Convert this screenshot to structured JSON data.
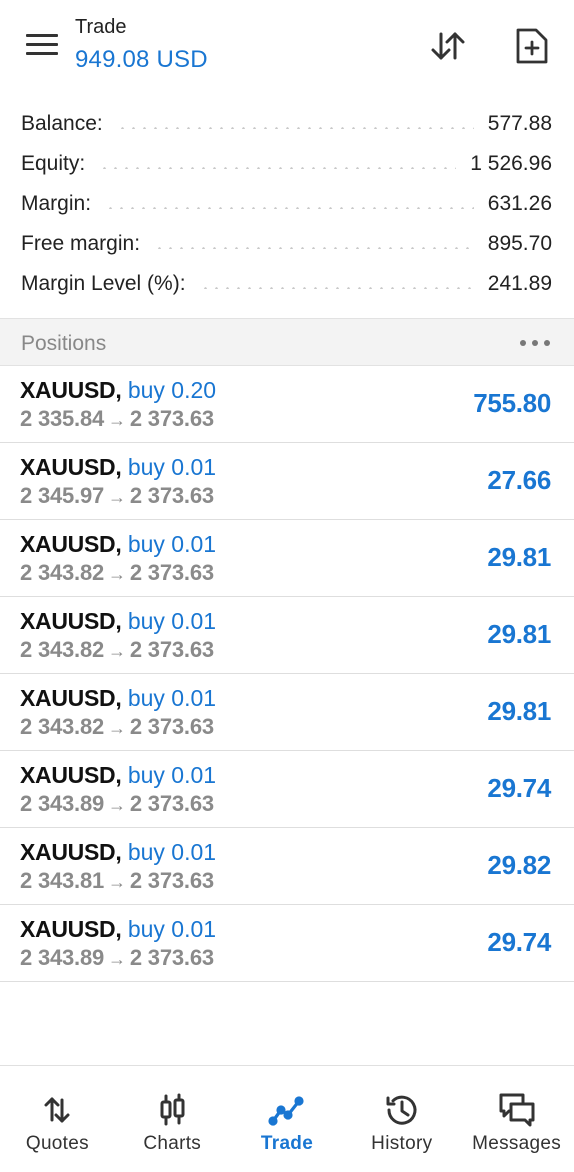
{
  "header": {
    "title": "Trade",
    "balance": "949.08 USD",
    "icons": [
      "menu-icon",
      "sort-icon",
      "new-order-icon"
    ]
  },
  "summary": [
    {
      "label": "Balance:",
      "value": "577.88"
    },
    {
      "label": "Equity:",
      "value": "1 526.96"
    },
    {
      "label": "Margin:",
      "value": "631.26"
    },
    {
      "label": "Free margin:",
      "value": "895.70"
    },
    {
      "label": "Margin Level (%):",
      "value": "241.89"
    }
  ],
  "positions_section": {
    "title": "Positions",
    "more_icon": "more-dots-icon"
  },
  "positions": [
    {
      "symbol": "XAUUSD,",
      "side": "buy 0.20",
      "open": "2 335.84",
      "arrow": "→",
      "current": "2 373.63",
      "profit": "755.80"
    },
    {
      "symbol": "XAUUSD,",
      "side": "buy 0.01",
      "open": "2 345.97",
      "arrow": "→",
      "current": "2 373.63",
      "profit": "27.66"
    },
    {
      "symbol": "XAUUSD,",
      "side": "buy 0.01",
      "open": "2 343.82",
      "arrow": "→",
      "current": "2 373.63",
      "profit": "29.81"
    },
    {
      "symbol": "XAUUSD,",
      "side": "buy 0.01",
      "open": "2 343.82",
      "arrow": "→",
      "current": "2 373.63",
      "profit": "29.81"
    },
    {
      "symbol": "XAUUSD,",
      "side": "buy 0.01",
      "open": "2 343.82",
      "arrow": "→",
      "current": "2 373.63",
      "profit": "29.81"
    },
    {
      "symbol": "XAUUSD,",
      "side": "buy 0.01",
      "open": "2 343.89",
      "arrow": "→",
      "current": "2 373.63",
      "profit": "29.74"
    },
    {
      "symbol": "XAUUSD,",
      "side": "buy 0.01",
      "open": "2 343.81",
      "arrow": "→",
      "current": "2 373.63",
      "profit": "29.82"
    },
    {
      "symbol": "XAUUSD,",
      "side": "buy 0.01",
      "open": "2 343.89",
      "arrow": "→",
      "current": "2 373.63",
      "profit": "29.74"
    }
  ],
  "nav": [
    {
      "label": "Quotes",
      "icon": "quotes-icon",
      "active": false
    },
    {
      "label": "Charts",
      "icon": "charts-icon",
      "active": false
    },
    {
      "label": "Trade",
      "icon": "trade-icon",
      "active": true
    },
    {
      "label": "History",
      "icon": "history-icon",
      "active": false
    },
    {
      "label": "Messages",
      "icon": "messages-icon",
      "active": false
    }
  ],
  "colors": {
    "accent": "#1976d2",
    "text": "#1a1a1a",
    "muted": "#8a8a8a",
    "section_bg": "#f3f3f3"
  }
}
